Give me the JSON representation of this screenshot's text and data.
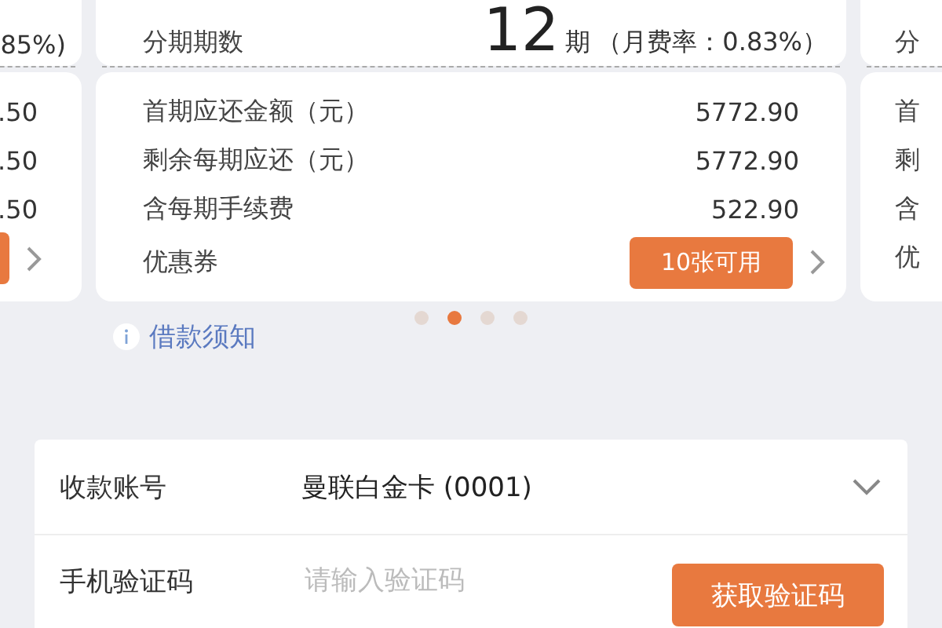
{
  "carousel": {
    "left_card": {
      "top_text": "85%)",
      "values": [
        ".50",
        ".50",
        ".50"
      ]
    },
    "center_card": {
      "term_label": "分期期数",
      "term_number": "12",
      "term_unit": "期",
      "rate_text": "（月费率：0.83%）",
      "rows": [
        {
          "label": "首期应还金额（元）",
          "value": "5772.90"
        },
        {
          "label": "剩余每期应还（元）",
          "value": "5772.90"
        },
        {
          "label": "含每期手续费",
          "value": "522.90"
        }
      ],
      "coupon": {
        "label": "优惠券",
        "button": "10张可用"
      }
    },
    "right_card": {
      "top_text": "分",
      "labels": [
        "首",
        "剩",
        "含",
        "优"
      ]
    }
  },
  "dots": [
    {
      "selected": false
    },
    {
      "selected": true
    },
    {
      "selected": false
    },
    {
      "selected": false
    }
  ],
  "notice_link": "借款须知",
  "form": {
    "account": {
      "label": "收款账号",
      "value": "曼联白金卡 (0001)"
    },
    "code": {
      "label": "手机验证码",
      "placeholder": "请输入验证码",
      "button": "获取验证码"
    }
  }
}
